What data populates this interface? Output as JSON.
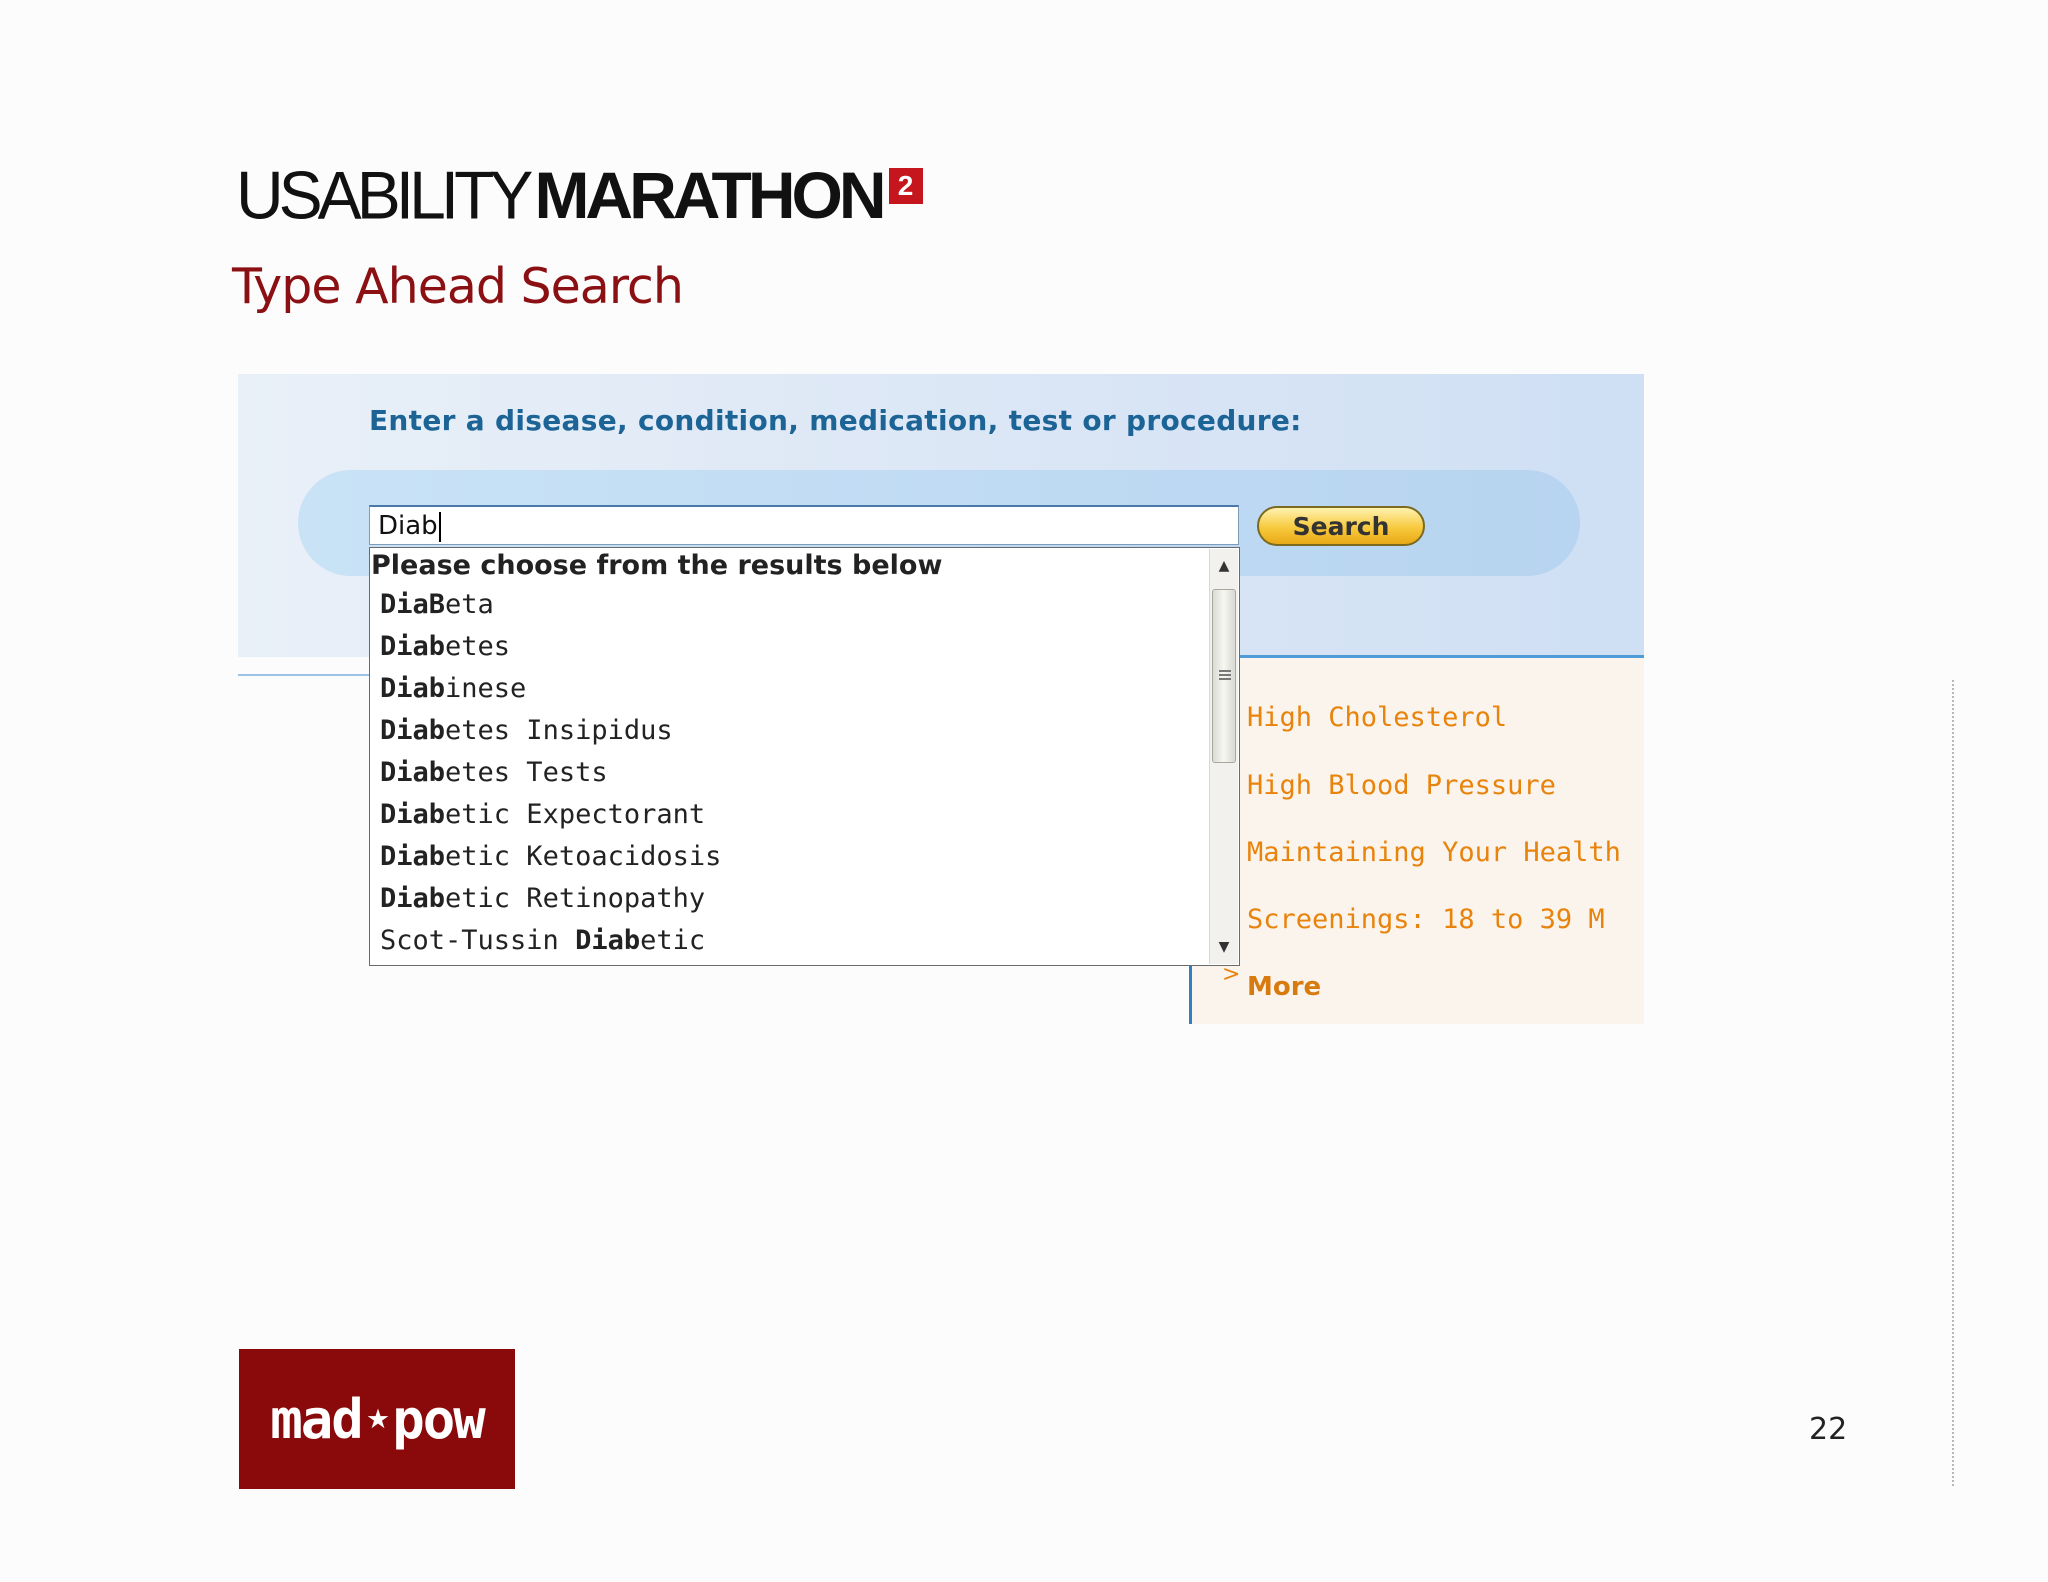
{
  "logo": {
    "light": "USABILITY",
    "bold": "MARATHON",
    "superscript": "2"
  },
  "slide_title": "Type Ahead Search",
  "search": {
    "prompt": "Enter a disease, condition, medication, test or procedure:",
    "value": "Diab",
    "button_label": "Search"
  },
  "dropdown": {
    "header": "Please choose from the results below",
    "items": [
      {
        "bold": "DiaB",
        "rest": "eta"
      },
      {
        "bold": "Diab",
        "rest": "etes"
      },
      {
        "bold": "Diab",
        "rest": "inese"
      },
      {
        "bold": "Diab",
        "rest": "etes Insipidus"
      },
      {
        "bold": "Diab",
        "rest": "etes Tests"
      },
      {
        "bold": "Diab",
        "rest": "etic Expectorant"
      },
      {
        "bold": "Diab",
        "rest": "etic Ketoacidosis"
      },
      {
        "bold": "Diab",
        "rest": "etic Retinopathy"
      },
      {
        "pre": "Scot-Tussin ",
        "bold": "Diab",
        "rest": "etic"
      }
    ]
  },
  "right_links": [
    "High Cholesterol",
    "High Blood Pressure",
    "Maintaining Your Health",
    "Screenings: 18 to 39  M"
  ],
  "more": {
    "arrow": ">",
    "label": "More"
  },
  "footer": {
    "brand": "mad⋆pow",
    "page_number": "22"
  }
}
